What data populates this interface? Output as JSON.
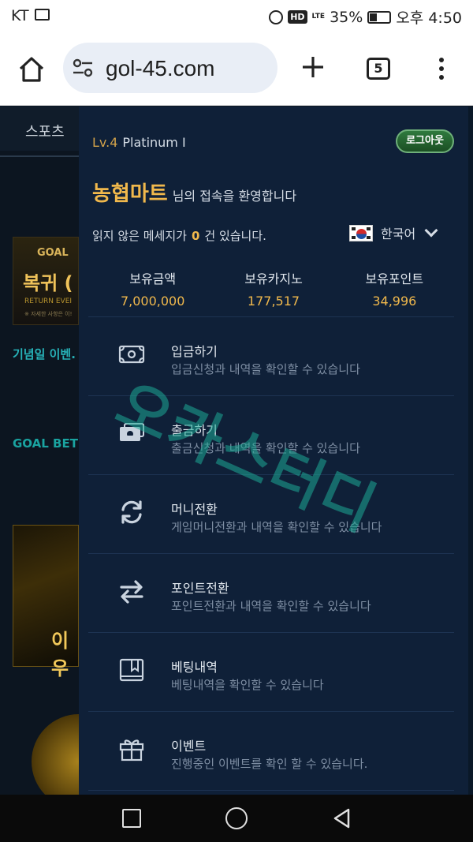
{
  "status_bar": {
    "carrier": "KT",
    "battery": "35%",
    "time": "오후 4:50",
    "network": "LTE"
  },
  "browser": {
    "url": "gol-45.com",
    "tab_count": "5"
  },
  "site": {
    "sports_tab": "스포츠",
    "banner_brand": "GOAL",
    "banner_title": "복귀 (",
    "banner_sub": "RETURN EVEI",
    "banner_note": "※ 자세한 사항은 이!",
    "event_label": "기념일 이벤.",
    "goalbet_label": "GOAL BET",
    "gold_text": "이우"
  },
  "panel": {
    "level": "Lv.4",
    "rank": "Platinum I",
    "logout_label": "로그아웃",
    "user_name": "농협마트",
    "welcome_text": "님의 접속을 환영합니다",
    "unread_prefix": "읽지 않은 메세지가",
    "unread_count": "0",
    "unread_suffix": "건 있습니다.",
    "language": "한국어",
    "balances": [
      {
        "label": "보유금액",
        "value": "7,000,000"
      },
      {
        "label": "보유카지노",
        "value": "177,517"
      },
      {
        "label": "보유포인트",
        "value": "34,996"
      }
    ],
    "menu": [
      {
        "icon": "cash-icon",
        "title": "입금하기",
        "desc": "입금신청과 내역을 확인할 수 있습니다"
      },
      {
        "icon": "cash-out-icon",
        "title": "출금하기",
        "desc": "출금신청과 내역을 확인할 수 있습니다"
      },
      {
        "icon": "refresh-icon",
        "title": "머니전환",
        "desc": "게임머니전환과 내역을 확인할 수 있습니다"
      },
      {
        "icon": "swap-icon",
        "title": "포인트전환",
        "desc": "포인트전환과 내역을 확인할 수 있습니다"
      },
      {
        "icon": "book-icon",
        "title": "베팅내역",
        "desc": "베팅내역을 확인할 수 있습니다"
      },
      {
        "icon": "gift-icon",
        "title": "이벤트",
        "desc": "진행중인 이벤트를 확인 할 수 있습니다."
      }
    ]
  },
  "colors": {
    "panel_bg": "#0f2038",
    "accent_gold": "#f0b84c",
    "logout_green": "#2f7a3e"
  }
}
